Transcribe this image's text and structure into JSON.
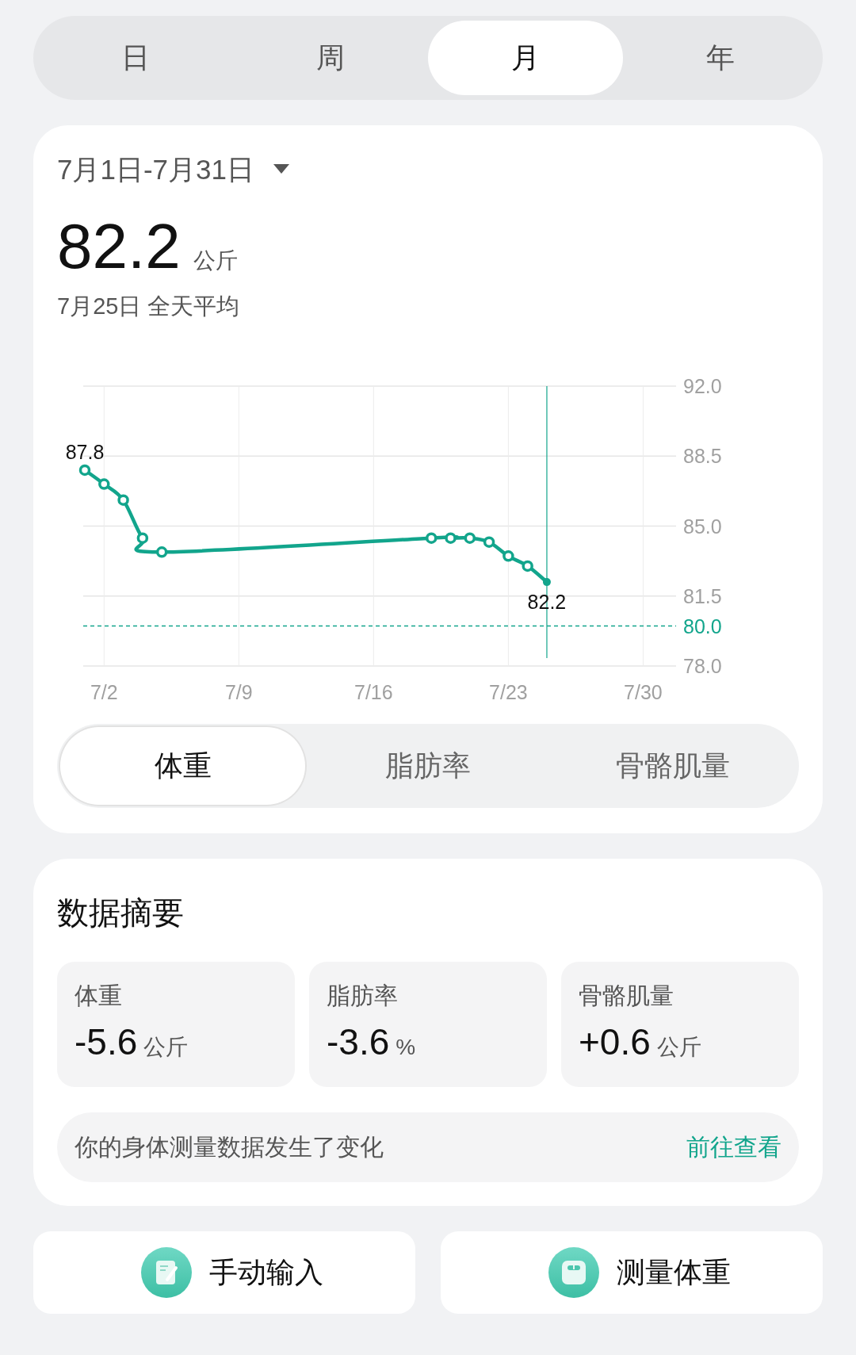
{
  "period_tabs": [
    {
      "label": "日",
      "selected": false
    },
    {
      "label": "周",
      "selected": false
    },
    {
      "label": "月",
      "selected": true
    },
    {
      "label": "年",
      "selected": false
    }
  ],
  "range": {
    "label": "7月1日-7月31日"
  },
  "reading": {
    "value": "82.2",
    "unit": "公斤",
    "caption": "7月25日 全天平均"
  },
  "chart": {
    "chart_data": {
      "type": "line",
      "categories": [
        null,
        "7/2",
        null,
        null,
        null,
        null,
        null,
        null,
        "7/9",
        null,
        null,
        null,
        null,
        null,
        null,
        "7/16",
        null,
        null,
        null,
        null,
        null,
        null,
        "7/23",
        null,
        null,
        null,
        null,
        null,
        null,
        "7/30",
        null
      ],
      "grid": true,
      "series": [
        {
          "color": "#12a58c",
          "marker": "circle",
          "values": [
            87.8,
            87.1,
            86.3,
            84.4,
            83.7,
            null,
            null,
            null,
            null,
            null,
            null,
            null,
            null,
            null,
            null,
            null,
            null,
            null,
            84.4,
            84.4,
            84.4,
            84.2,
            83.5,
            83.0,
            82.2,
            null,
            null,
            null,
            null,
            null,
            null
          ]
        }
      ],
      "ylim": [
        78,
        92
      ],
      "yticks": [
        {
          "value": 78,
          "label": "78.0"
        },
        {
          "value": 81.5,
          "label": "81.5"
        },
        {
          "value": 85,
          "label": "85.0"
        },
        {
          "value": 88.5,
          "label": "88.5"
        },
        {
          "value": 92,
          "label": "92.0"
        }
      ],
      "annotations": [
        "87.8",
        "82.2"
      ],
      "ref_lines": [
        {
          "axis": "y",
          "value": 80,
          "label": "80.0"
        }
      ]
    }
  },
  "metric_tabs": [
    {
      "label": "体重",
      "selected": true
    },
    {
      "label": "脂肪率",
      "selected": false
    },
    {
      "label": "骨骼肌量",
      "selected": false
    }
  ],
  "summary": {
    "title": "数据摘要",
    "stats": [
      {
        "label": "体重",
        "value": "-5.6",
        "unit": "公斤"
      },
      {
        "label": "脂肪率",
        "value": "-3.6",
        "unit": "%"
      },
      {
        "label": "骨骼肌量",
        "value": "+0.6",
        "unit": "公斤"
      }
    ],
    "notice": {
      "text": "你的身体测量数据发生了变化",
      "link": "前往查看"
    }
  },
  "actions": [
    {
      "kind": "note",
      "label": "手动输入"
    },
    {
      "kind": "scale",
      "label": "测量体重"
    }
  ]
}
